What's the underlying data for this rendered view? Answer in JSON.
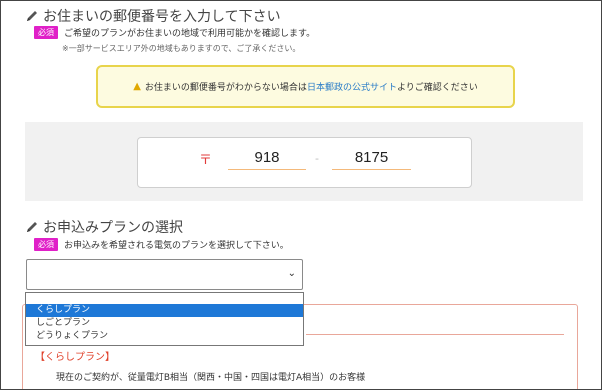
{
  "postal_section": {
    "title": "お住まいの郵便番号を入力して下さい",
    "required_badge": "必須",
    "instruction": "ご希望のプランがお住まいの地域で利用可能かを確認します。",
    "note": "※一部サービスエリア外の地域もありますので、ご了承ください。",
    "notice": {
      "icon": "warning-icon",
      "text_before": "お住まいの郵便番号がわからない場合は",
      "link_text": "日本郵政の公式サイト",
      "text_after": "よりご確認ください"
    },
    "zip_mark": "〒",
    "zip_first": "918",
    "zip_separator": "-",
    "zip_second": "8175"
  },
  "plan_section": {
    "title": "お申込みプランの選択",
    "required_badge": "必須",
    "instruction": "お申込みを希望される電気のプランを選択して下さい。",
    "selected_value": "",
    "options": [
      "くらしプラン",
      "しごとプラン",
      "どうりょくプラン"
    ],
    "highlighted_option_index": 0,
    "card": {
      "plan_name": "【くらしプラン】",
      "description": "現在のご契約が、従量電灯B相当（関西・中国・四国は電灯A相当）のお客様"
    }
  },
  "colors": {
    "badge": "#e020c8",
    "link": "#2a7cc7",
    "notice_border": "#e8d44b",
    "highlight": "#1e78d7",
    "accent_red": "#e0402a"
  }
}
